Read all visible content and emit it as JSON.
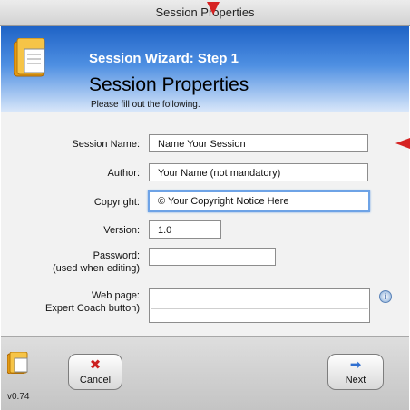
{
  "window": {
    "title": "Session Properties"
  },
  "header": {
    "step": "Session Wizard: Step 1",
    "title": "Session Properties",
    "subtitle": "Please fill out the following."
  },
  "form": {
    "session_name": {
      "label": "Session Name:",
      "value": "Name Your Session"
    },
    "author": {
      "label": "Author:",
      "value": "Your Name (not mandatory)"
    },
    "copyright": {
      "label": "Copyright:",
      "value": "© Your Copyright Notice Here"
    },
    "version": {
      "label": "Version:",
      "value": "1.0"
    },
    "password": {
      "label": "Password:",
      "label_note": "(used when editing)",
      "value": ""
    },
    "web_page": {
      "label": "Web page:",
      "label_note": "Expert Coach button)",
      "value": ""
    }
  },
  "footer": {
    "version": "v0.74",
    "cancel_label": "Cancel",
    "next_label": "Next"
  },
  "colors": {
    "header_blue": "#1f63c6",
    "annotation_red": "#d62222",
    "focus_ring": "#6ea3e6"
  }
}
